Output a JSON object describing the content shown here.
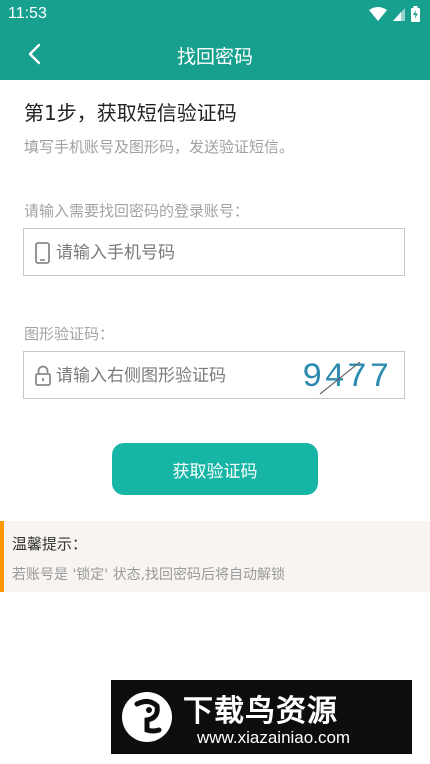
{
  "status_bar": {
    "time": "11:53"
  },
  "app_bar": {
    "title": "找回密码"
  },
  "step": {
    "title": "第1步，获取短信验证码",
    "description": "填写手机账号及图形码，发送验证短信。"
  },
  "account": {
    "label": "请输入需要找回密码的登录账号：",
    "placeholder": "请输入手机号码",
    "value": ""
  },
  "captcha": {
    "label": "图形验证码：",
    "placeholder": "请输入右侧图形验证码",
    "value": "",
    "image_text": "9477"
  },
  "actions": {
    "get_code_label": "获取验证码"
  },
  "tips": {
    "title": "温馨提示：",
    "text": "若账号是 '锁定' 状态,找回密码后将自动解锁"
  },
  "watermark": {
    "title": "下载鸟资源",
    "url": "www.xiazainiao.com"
  },
  "colors": {
    "primary": "#17a08e",
    "button": "#17b5a5",
    "tip_accent": "#ff9800",
    "tip_bg": "#f7f4f1"
  },
  "icons": [
    "wifi-icon",
    "signal-icon",
    "battery-icon",
    "back-arrow-icon",
    "phone-icon",
    "lock-icon"
  ]
}
